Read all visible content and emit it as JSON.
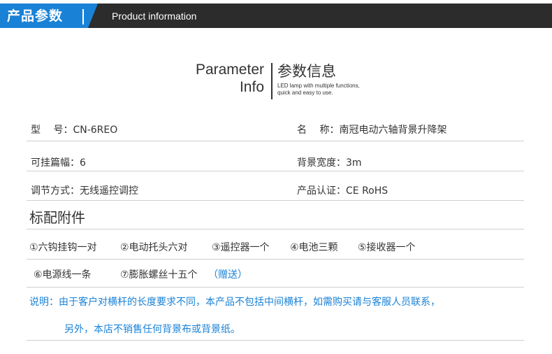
{
  "header": {
    "title_cn": "产品参数",
    "title_en": "Product information"
  },
  "intro": {
    "title_en_line1": "Parameter",
    "title_en_line2": "Info",
    "title_cn": "参数信息",
    "subtitle_line1": "LED lamp with multiple functions,",
    "subtitle_line2": "quick and easy to use."
  },
  "specs": {
    "model": "型　  号：CN-6REO",
    "name": "名　  称：南冠电动六轴背景升降架",
    "hangers": "可挂篇幅：6",
    "width": "背景宽度：3m",
    "control": "调节方式：无线遥控调控",
    "cert": "产品认证：CE RoHS"
  },
  "accessories": {
    "title": "标配附件",
    "items": [
      "①六钩挂钩一对",
      "②电动托头六对",
      "③遥控器一个",
      "④电池三颗",
      "⑤接收器一个",
      "⑥电源线一条",
      "⑦膨胀螺丝十五个"
    ],
    "gift_label": "（赠送）"
  },
  "notes": {
    "line1": "说明：由于客户对横杆的长度要求不同，本产品不包括中间横杆，如需购买请与客服人员联系，",
    "line2": "另外，本店不销售任何背景布或背景纸。"
  },
  "colors": {
    "accent_blue": "#1a82d6",
    "header_dark": "#2c2c2c",
    "text": "#333333"
  }
}
